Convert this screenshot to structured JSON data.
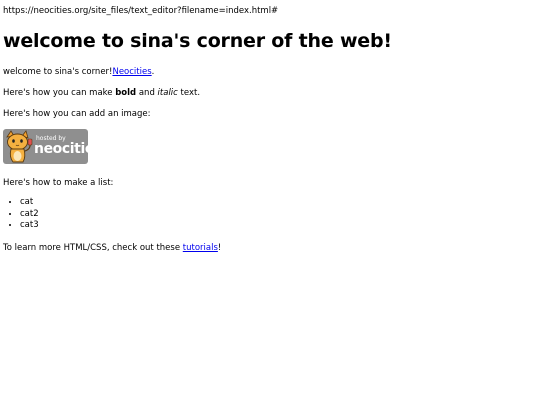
{
  "browser": {
    "url": "https://neocities.org/site_files/text_editor?filename=index.html#"
  },
  "page": {
    "heading": "welcome to sina's corner of the web!",
    "intro": {
      "text": "welcome to sina's corner!",
      "link": "Neocities",
      "suffix": "."
    },
    "formatting": {
      "prefix": "Here's how you can make ",
      "bold": "bold",
      "middle": " and ",
      "italic": "italic",
      "suffix": " text."
    },
    "image_intro": "Here's how you can add an image:",
    "badge": {
      "small_text": "hosted by",
      "big_text": "neocities"
    },
    "list_intro": "Here's how to make a list:",
    "list_items": [
      "cat",
      "cat2",
      "cat3"
    ],
    "outro": {
      "prefix": "To learn more HTML/CSS, check out these ",
      "link": "tutorials",
      "suffix": "!"
    }
  },
  "colors": {
    "link": "#0000ee",
    "badge_bg": "#8f8f8f"
  }
}
